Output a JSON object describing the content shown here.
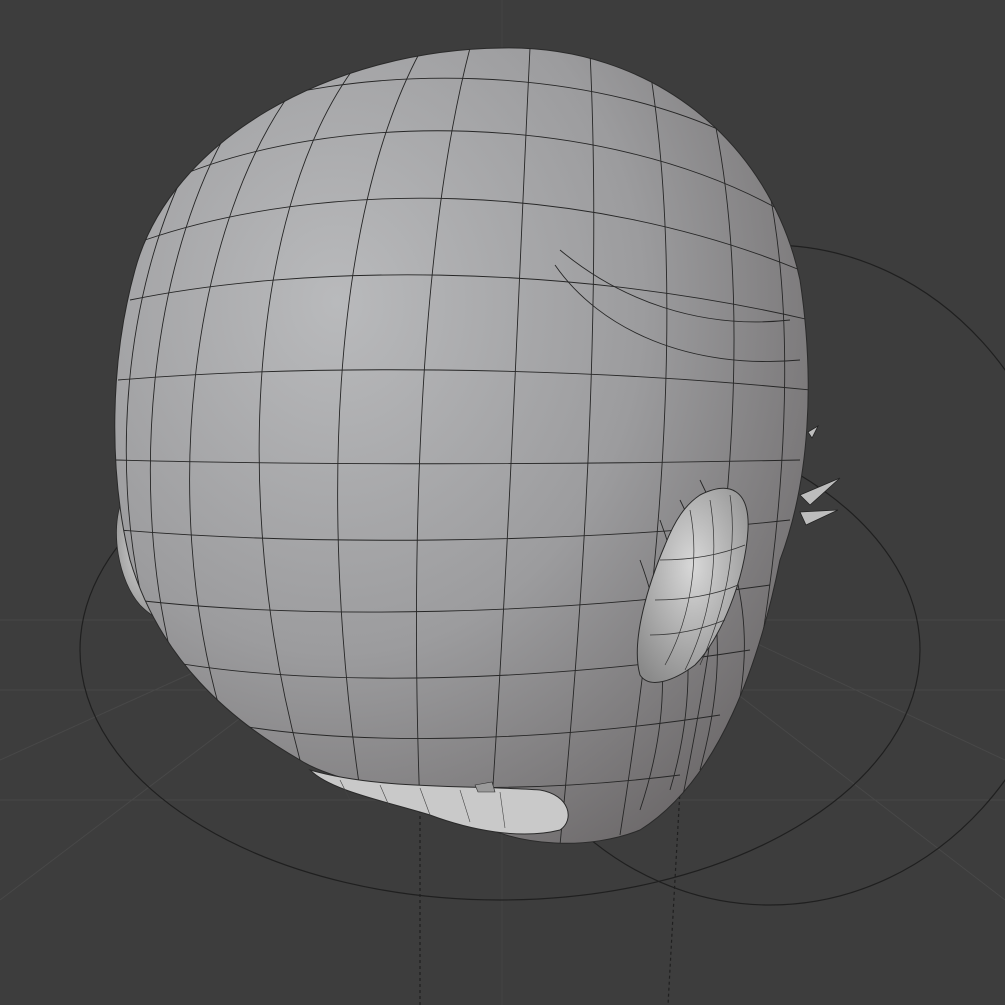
{
  "viewport": {
    "background_color": "#3d3d3d",
    "grid_color": "#4a4a4a",
    "mesh_color": "#a6a6a6",
    "wire_color": "#1e1e1e",
    "object": "head-mesh",
    "shading": "solid",
    "wireframe_overlay": true
  }
}
